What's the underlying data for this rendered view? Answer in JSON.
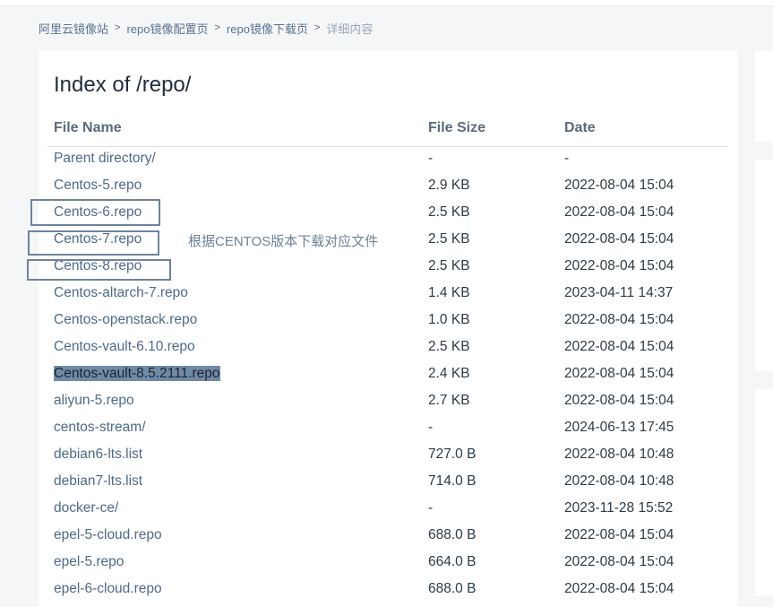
{
  "breadcrumb": {
    "items": [
      "阿里云镜像站",
      "repo镜像配置页",
      "repo镜像下载页"
    ],
    "current": "详细内容",
    "separator": ">"
  },
  "page": {
    "title": "Index of /repo/"
  },
  "table": {
    "headers": {
      "name": "File Name",
      "size": "File Size",
      "date": "Date"
    },
    "rows": [
      {
        "name": "Parent directory/",
        "size": "-",
        "date": "-"
      },
      {
        "name": "Centos-5.repo",
        "size": "2.9 KB",
        "date": "2022-08-04 15:04"
      },
      {
        "name": "Centos-6.repo",
        "size": "2.5 KB",
        "date": "2022-08-04 15:04"
      },
      {
        "name": "Centos-7.repo",
        "size": "2.5 KB",
        "date": "2022-08-04 15:04"
      },
      {
        "name": "Centos-8.repo",
        "size": "2.5 KB",
        "date": "2022-08-04 15:04"
      },
      {
        "name": "Centos-altarch-7.repo",
        "size": "1.4 KB",
        "date": "2023-04-11 14:37"
      },
      {
        "name": "Centos-openstack.repo",
        "size": "1.0 KB",
        "date": "2022-08-04 15:04"
      },
      {
        "name": "Centos-vault-6.10.repo",
        "size": "2.5 KB",
        "date": "2022-08-04 15:04"
      },
      {
        "name": "Centos-vault-8.5.2111.repo",
        "size": "2.4 KB",
        "date": "2022-08-04 15:04"
      },
      {
        "name": "aliyun-5.repo",
        "size": "2.7 KB",
        "date": "2022-08-04 15:04"
      },
      {
        "name": "centos-stream/",
        "size": "-",
        "date": "2024-06-13 17:45"
      },
      {
        "name": "debian6-lts.list",
        "size": "727.0 B",
        "date": "2022-08-04 10:48"
      },
      {
        "name": "debian7-lts.list",
        "size": "714.0 B",
        "date": "2022-08-04 10:48"
      },
      {
        "name": "docker-ce/",
        "size": "-",
        "date": "2023-11-28 15:52"
      },
      {
        "name": "epel-5-cloud.repo",
        "size": "688.0 B",
        "date": "2022-08-04 15:04"
      },
      {
        "name": "epel-5.repo",
        "size": "664.0 B",
        "date": "2022-08-04 15:04"
      },
      {
        "name": "epel-6-cloud.repo",
        "size": "688.0 B",
        "date": "2022-08-04 15:04"
      }
    ]
  },
  "annotation": {
    "text": "根据CENTOS版本下载对应文件"
  },
  "colors": {
    "link": "#4e6a8a",
    "highlight": "#6f8aa6",
    "box": "#6f849b"
  }
}
